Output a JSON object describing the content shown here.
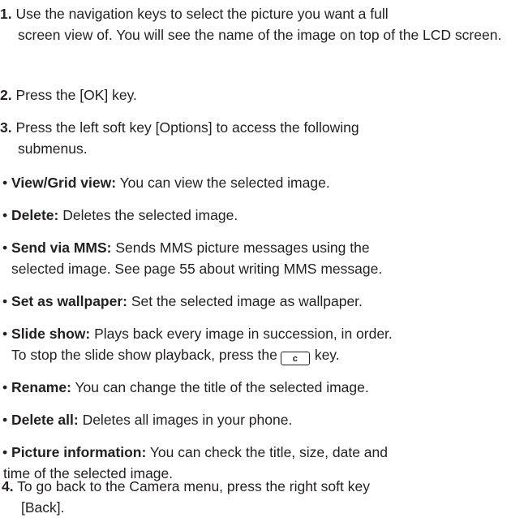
{
  "steps": [
    {
      "num": "1.",
      "line1": " Use the navigation keys to select the picture you want a full",
      "rest": "screen view of. You will see the name of the image on top of the LCD screen."
    },
    {
      "num": "2.",
      "line1": " Press the [OK] key."
    },
    {
      "num": "3.",
      "line1": " Press the left soft key [Options] to access the following",
      "rest": "submenus."
    },
    {
      "num": "4.",
      "line1": " To go back to the Camera menu, press the right soft key",
      "rest": "[Back]."
    }
  ],
  "submenus": [
    {
      "term": "View/Grid view:",
      "desc": " You can view the selected image."
    },
    {
      "term": "Delete:",
      "desc": " Deletes the selected image."
    },
    {
      "term": "Send via MMS:",
      "desc": " Sends MMS picture messages using the",
      "cont": "selected image. See page 55 about writing MMS message."
    },
    {
      "term": "Set as wallpaper:",
      "desc": " Set the selected image as wallpaper."
    },
    {
      "term": "Slide show:",
      "desc": " Plays back every image in succession, in order.",
      "cont_a": "To stop the slide show playback, press the",
      "key": "c",
      "cont_b": "key."
    },
    {
      "term": "Rename:",
      "desc": " You can change the title of the selected image."
    },
    {
      "term": "Delete all:",
      "desc": " Deletes all images in your phone."
    },
    {
      "term": "Picture information:",
      "desc": " You can check the title, size, date and",
      "cont": "time of the selected image."
    }
  ],
  "bullet_char": "•"
}
